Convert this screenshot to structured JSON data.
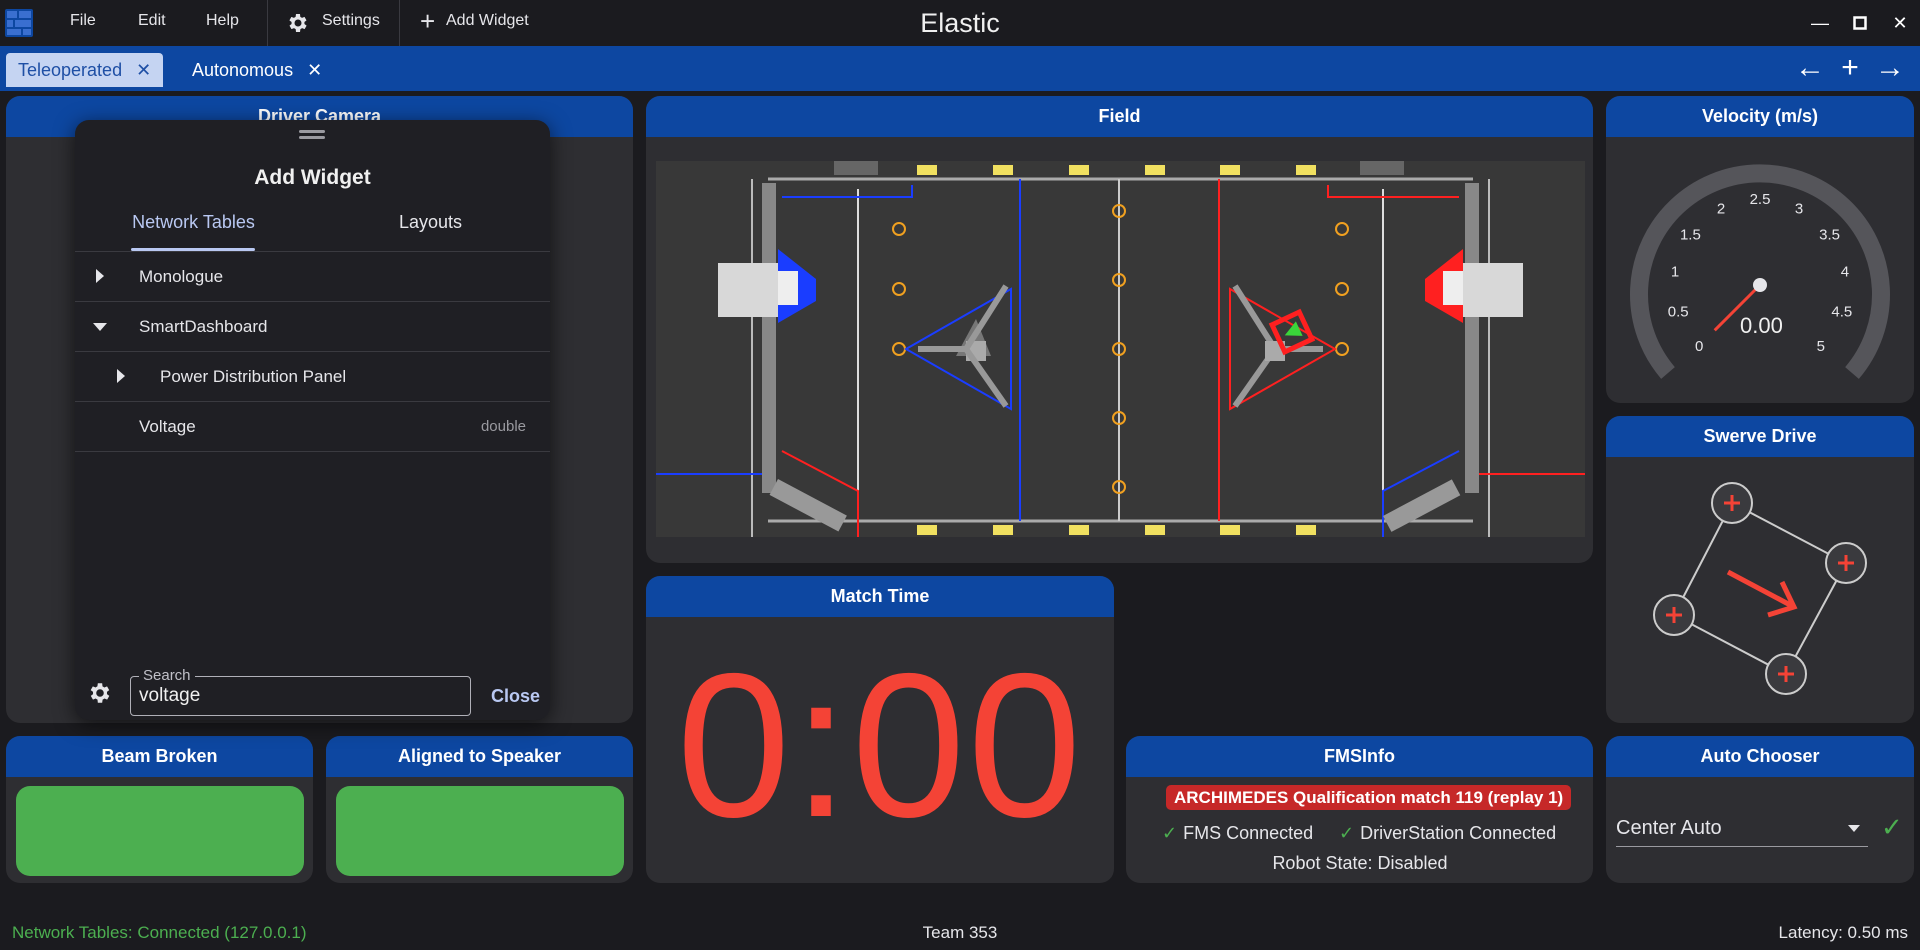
{
  "window": {
    "title": "Elastic"
  },
  "menu": {
    "file": "File",
    "edit": "Edit",
    "help": "Help",
    "settings": "Settings",
    "add_widget": "Add Widget"
  },
  "tabs": [
    {
      "label": "Teleoperated",
      "active": true
    },
    {
      "label": "Autonomous",
      "active": false
    }
  ],
  "widgets": {
    "driver_camera": {
      "title": "Driver Camera"
    },
    "field": {
      "title": "Field"
    },
    "velocity": {
      "title": "Velocity (m/s)",
      "value": "0.00",
      "ticks": [
        "0",
        "0.5",
        "1",
        "1.5",
        "2",
        "2.5",
        "3",
        "3.5",
        "4",
        "4.5",
        "5"
      ],
      "gauge_value": 0
    },
    "swerve": {
      "title": "Swerve Drive"
    },
    "match_time": {
      "title": "Match Time",
      "value": "0:00"
    },
    "beam_broken": {
      "title": "Beam Broken",
      "state": true
    },
    "aligned": {
      "title": "Aligned to Speaker",
      "state": true
    },
    "fms": {
      "title": "FMSInfo",
      "event": "ARCHIMEDES Qualification match 119 (replay 1)",
      "fms_connected": "FMS Connected",
      "ds_connected": "DriverStation Connected",
      "robot_state": "Robot State: Disabled"
    },
    "auto_chooser": {
      "title": "Auto Chooser",
      "selected": "Center Auto"
    }
  },
  "dialog": {
    "title": "Add Widget",
    "tab_nt": "Network Tables",
    "tab_layouts": "Layouts",
    "tree": [
      {
        "label": "Monologue",
        "expanded": false,
        "indent": 0,
        "type": ""
      },
      {
        "label": "SmartDashboard",
        "expanded": true,
        "indent": 0,
        "type": ""
      },
      {
        "label": "Power Distribution Panel",
        "expanded": false,
        "indent": 1,
        "type": ""
      },
      {
        "label": "Voltage",
        "expanded": null,
        "indent": 0,
        "type": "double"
      }
    ],
    "search_label": "Search",
    "search_value": "voltage",
    "close": "Close"
  },
  "statusbar": {
    "nt": "Network Tables: Connected (127.0.0.1)",
    "team": "Team 353",
    "latency": "Latency:  0.50 ms"
  },
  "colors": {
    "accent": "#0d47a1",
    "true_green": "#4caf50",
    "match_time_red": "#f44336",
    "alert_red": "#c62828"
  }
}
